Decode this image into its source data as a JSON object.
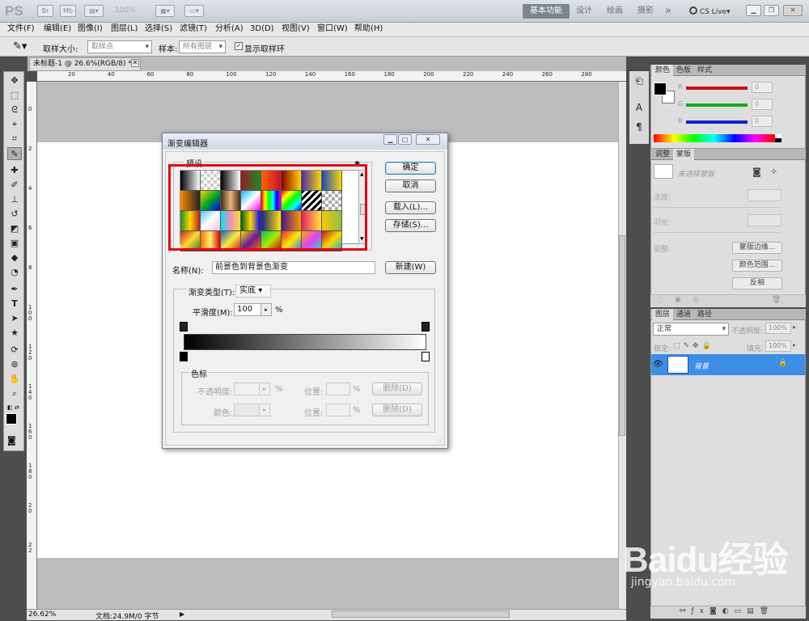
{
  "appbar": {
    "logo": "PS",
    "zoom": "100%",
    "workspaces": [
      "基本功能",
      "设计",
      "绘画",
      "摄影"
    ],
    "more": "»",
    "cs_live": "CS Live"
  },
  "menu": [
    "文件(F)",
    "编辑(E)",
    "图像(I)",
    "图层(L)",
    "选择(S)",
    "滤镜(T)",
    "分析(A)",
    "3D(D)",
    "视图(V)",
    "窗口(W)",
    "帮助(H)"
  ],
  "options": {
    "sample_size_label": "取样大小:",
    "sample_size_value": "取样点",
    "sample_label": "样本:",
    "sample_value": "所有图层",
    "show_ring": "显示取样环"
  },
  "document": {
    "tab_title": "未标题-1 @ 26.6%(RGB/8) *",
    "ruler_top": [
      "20",
      "40",
      "60",
      "80",
      "100",
      "120",
      "140",
      "160",
      "180",
      "200",
      "220",
      "240",
      "260",
      "280"
    ],
    "ruler_left": [
      "0",
      "2",
      "4",
      "6",
      "8",
      "1 0 0",
      "1 2 0",
      "1 4 0",
      "1 6 0",
      "1 8 0",
      "2 0",
      "2 2"
    ],
    "zoom": "26.62%",
    "doc_info": "文档:24.9M/0 字节"
  },
  "color_panel": {
    "tabs": [
      "颜色",
      "色板",
      "样式"
    ],
    "channels": [
      {
        "label": "R",
        "value": "0",
        "color": "#cc1111"
      },
      {
        "label": "G",
        "value": "0",
        "color": "#11aa22"
      },
      {
        "label": "B",
        "value": "0",
        "color": "#1122cc"
      }
    ]
  },
  "adjust_panel": {
    "tabs": [
      "调整",
      "蒙版"
    ],
    "mask_label": "未选择蒙版",
    "density": "浓度:",
    "feather": "羽化:",
    "refine": "调整:",
    "buttons": [
      "蒙版边缘...",
      "颜色范围...",
      "反相"
    ]
  },
  "layers_panel": {
    "tabs": [
      "图层",
      "通道",
      "路径"
    ],
    "blend_mode": "正常",
    "opacity_label": "不透明度:",
    "opacity_value": "100%",
    "lock_label": "锁定:",
    "fill_label": "填充:",
    "fill_value": "100%",
    "layer_name": "背景"
  },
  "dialog": {
    "title": "渐变编辑器",
    "presets_label": "预设",
    "ok": "确定",
    "cancel": "取消",
    "load": "载入(L)...",
    "save": "存储(S)...",
    "name_label": "名称(N):",
    "name_value": "前景色到背景色渐变",
    "new": "新建(W)",
    "gradient_type_label": "渐变类型(T):",
    "gradient_type_value": "实底",
    "smoothness_label": "平滑度(M):",
    "smoothness_value": "100",
    "pct": "%",
    "stops_label": "色标",
    "opacity_label": "不透明度:",
    "color_label": "颜色:",
    "location_label": "位置:",
    "delete": "删除(D)"
  },
  "watermark": {
    "main": "Baidu经验",
    "sub": "jingyan.baidu.com"
  }
}
